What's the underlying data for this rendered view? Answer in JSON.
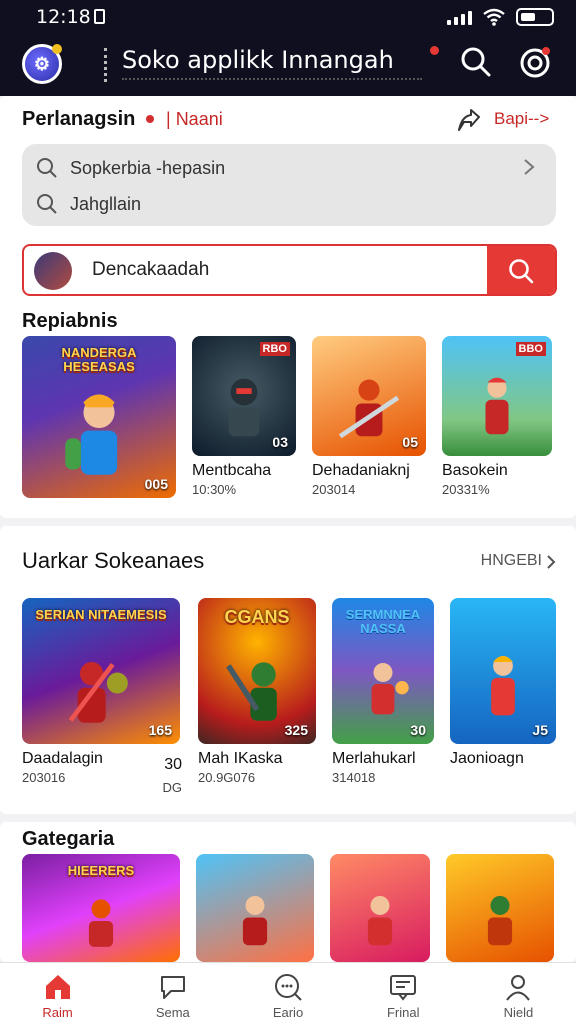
{
  "status": {
    "time": "12:18"
  },
  "header": {
    "title": "Soko applikk Innangah"
  },
  "featured": {
    "title": "Perlanagsin",
    "subtitle": "Naani",
    "link": "Bapi-->",
    "search_rows": [
      {
        "label": "Sopkerbia -hepasin"
      },
      {
        "label": "Jahgllain"
      }
    ],
    "query": "Dencakaadah",
    "row_title": "Repiabnis",
    "cards": [
      {
        "banner": "NANDERGA HESEASAS",
        "badge": "005",
        "name": "",
        "meta": ""
      },
      {
        "badge": "03",
        "top": "RBO",
        "name": "Mentbcaha",
        "meta": "10:30% "
      },
      {
        "badge": "05",
        "name": "Dehadaniaknj",
        "meta": "203014"
      },
      {
        "badge": "",
        "top": "BBO",
        "name": "Basokein",
        "meta": "20331% "
      }
    ]
  },
  "section2": {
    "title": "Uarkar Sokeanaes",
    "link": "HNGEBI",
    "cards": [
      {
        "banner": "SERIAN NITAEMESIS",
        "badge": "165",
        "name": "Daadalagin",
        "meta": "203016",
        "extra_name": "30",
        "extra_meta": "DG"
      },
      {
        "banner": "CGANS",
        "badge": "325",
        "name": "Mah IKaska",
        "meta": "20.9G076"
      },
      {
        "banner": "SERMNNEA NASSA",
        "badge": "30",
        "name": "Merlahukarl",
        "meta": "314018"
      },
      {
        "badge": "J5",
        "name": "Jaonioagn",
        "meta": ""
      }
    ]
  },
  "section3": {
    "title": "Gategaria",
    "cards": [
      {
        "banner": "HIEERERS"
      },
      {
        "banner": ""
      },
      {
        "banner": ""
      },
      {
        "banner": ""
      }
    ]
  },
  "nav": [
    {
      "label": "Raim",
      "icon": "home-icon",
      "active": true
    },
    {
      "label": "Sema",
      "icon": "chat-icon"
    },
    {
      "label": "Eario",
      "icon": "search-chat-icon"
    },
    {
      "label": "Frinal",
      "icon": "message-icon"
    },
    {
      "label": "Nield",
      "icon": "profile-icon"
    }
  ],
  "colors": {
    "accent": "#e53935",
    "header_bg": "#0f0f1f"
  }
}
